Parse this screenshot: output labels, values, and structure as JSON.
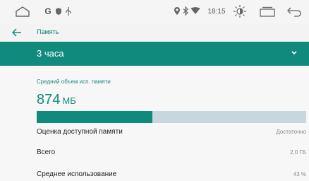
{
  "status_bar": {
    "notification_text": "G",
    "time": "18:15"
  },
  "app_bar": {
    "title": "Память"
  },
  "period_selector": {
    "value": "3 часа"
  },
  "memory": {
    "caption": "Средний объем исп. памяти",
    "value": "874",
    "unit": "МБ",
    "usage_fraction": 0.43
  },
  "rows": [
    {
      "label": "Оценка доступной памяти",
      "value": "Достаточно"
    },
    {
      "label": "Всего",
      "value": "2,0 ГБ"
    },
    {
      "label": "Среднее использование",
      "value": "43 %"
    }
  ],
  "colors": {
    "accent": "#0f8a7c",
    "bar_track": "#c8d7dd"
  }
}
